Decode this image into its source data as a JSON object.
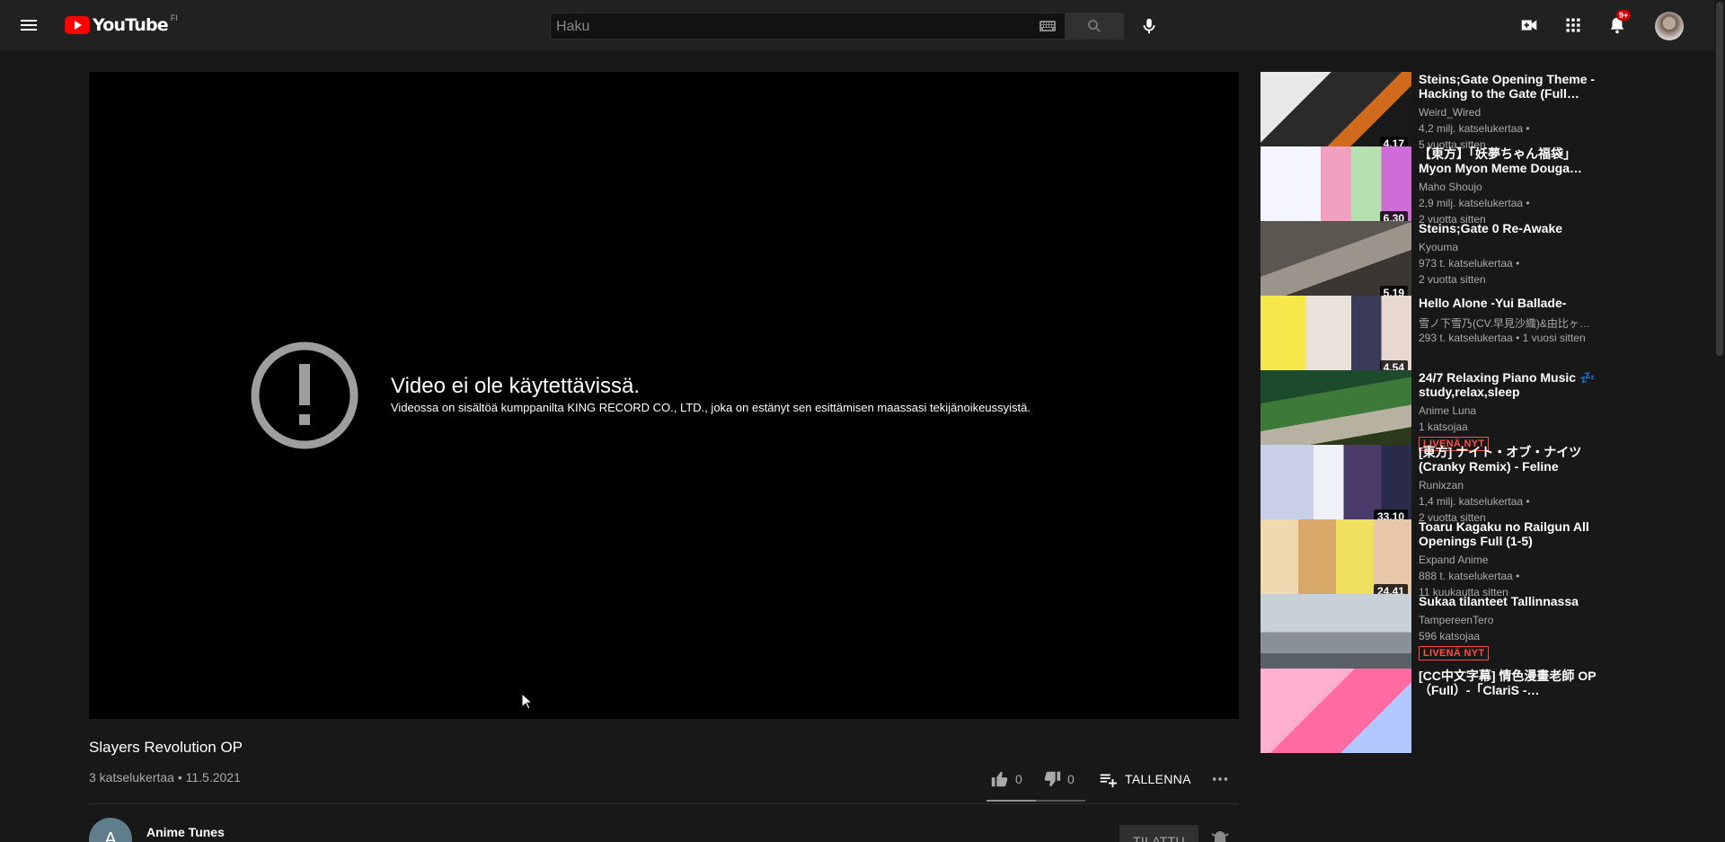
{
  "header": {
    "logo_text": "YouTube",
    "region": "FI",
    "search_placeholder": "Haku",
    "notification_count": "9+"
  },
  "player": {
    "error_title": "Video ei ole käytettävissä.",
    "error_message": "Videossa on sisältöä kumppanilta KING RECORD CO., LTD., joka on estänyt sen esittämisen maassasi tekijänoikeussyistä."
  },
  "video": {
    "title": "Slayers Revolution OP",
    "meta": "3 katselukertaa • 11.5.2021",
    "likes": "0",
    "dislikes": "0",
    "save_label": "TALLENNA",
    "like_ratio": 0.5
  },
  "channel": {
    "initial": "A",
    "name": "Anime Tunes",
    "subscribe_label": "TILATTU"
  },
  "related": [
    {
      "title": "Steins;Gate Opening Theme - Hacking to the Gate (Full…",
      "channel": "Weird_Wired",
      "line1": "4,2 milj. katselukertaa •",
      "line2": "5 vuotta sitten",
      "duration": "4.17",
      "live": "",
      "watched": 1.0
    },
    {
      "title": "【東方】「妖夢ちゃん福袋」Myon Myon Meme Douga…",
      "channel": "Maho Shoujo",
      "line1": "2,9 milj. katselukertaa •",
      "line2": "2 vuotta sitten",
      "duration": "6.30",
      "live": "",
      "watched": 1.0
    },
    {
      "title": "Steins;Gate 0 Re-Awake",
      "channel": "Kyouma",
      "line1": "973 t. katselukertaa •",
      "line2": "2 vuotta sitten",
      "duration": "5.19",
      "live": "",
      "watched": 0
    },
    {
      "title": "Hello Alone -Yui Ballade-",
      "channel": "雪ノ下雪乃(CV.早見沙織)&由比ヶ…",
      "line1": "293 t. katselukertaa • 1 vuosi sitten",
      "line2": "",
      "duration": "4.54",
      "live": "",
      "watched": 1.0
    },
    {
      "title": "24/7 Relaxing Piano Music 💤 study,relax,sleep",
      "channel": "Anime Luna",
      "line1": "1 katsojaa",
      "line2": "",
      "duration": "",
      "live": "LIVENÄ NYT",
      "watched": 0
    },
    {
      "title": "[東方] ナイト・オブ・ナイツ (Cranky Remix) - Feline Groo…",
      "channel": "Runixzan",
      "line1": "1,4 milj. katselukertaa •",
      "line2": "2 vuotta sitten",
      "duration": "33.10",
      "live": "",
      "watched": 1.0
    },
    {
      "title": "Toaru Kagaku no Railgun All Openings Full (1-5)",
      "channel": "Expand Anime",
      "line1": "888 t. katselukertaa •",
      "line2": "11 kuukautta sitten",
      "duration": "24.41",
      "live": "",
      "watched": 0
    },
    {
      "title": "Sukaa tilanteet Tallinnassa",
      "channel": "TampereenTero",
      "line1": "596 katsojaa",
      "line2": "",
      "duration": "",
      "live": "LIVENÄ NYT",
      "watched": 1.0
    },
    {
      "title": "[CC中文字幕] 情色漫畫老師 OP （Full）-「ClariS -…",
      "channel": "",
      "line1": "",
      "line2": "",
      "duration": "",
      "live": "",
      "watched": 0
    }
  ]
}
